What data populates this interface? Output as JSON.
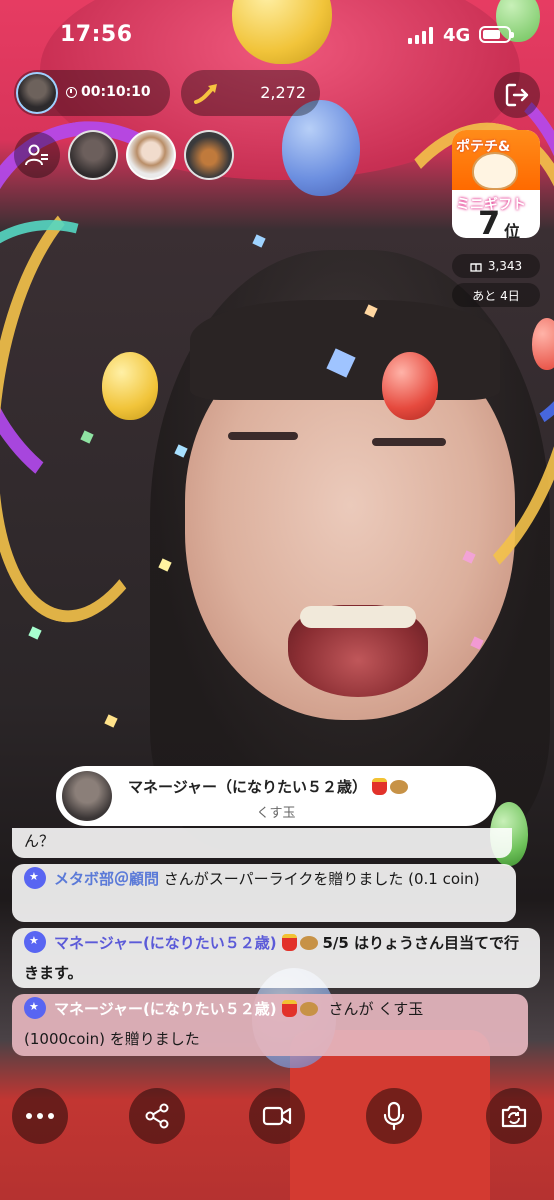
{
  "status_bar": {
    "time": "17:56",
    "network": "4G"
  },
  "stream": {
    "elapsed_time": "00:10:10",
    "score": "2,272",
    "icons": {
      "timer": "clock-icon",
      "score": "trend-arrow-icon",
      "exit": "exit-icon",
      "viewers": "viewer-list-icon"
    }
  },
  "event": {
    "title_line1": "ポテチ&",
    "title_line2": "ミニギフト",
    "rank": "7",
    "rank_unit": "位",
    "gift_count": "3,343",
    "days_left": "あと 4日"
  },
  "gift_banner": {
    "sender": "マネージャー（になりたい５２歳）",
    "item": "くす玉"
  },
  "comments": [
    {
      "id": "c0",
      "text": "ん？"
    },
    {
      "id": "c1",
      "user": "メタボ部＠顧問",
      "text": "さんがスーパーライクを贈りました (0.1 coin)"
    },
    {
      "id": "c2",
      "user": "マネージャー(になりたい５２歳)",
      "text": "5/5 はりょうさん目当てで行きます。"
    },
    {
      "id": "c3",
      "user": "マネージャー(になりたい５２歳)",
      "text_part1": "さんが くす玉",
      "text_part2": "(1000coin) を贈りました"
    }
  ],
  "bottom_bar": {
    "icons": [
      "more-icon",
      "share-icon",
      "video-camera-icon",
      "microphone-icon",
      "camera-flip-icon"
    ]
  },
  "colors": {
    "accent": "#5865f2",
    "gift_highlight": "#e4b5bd",
    "event_orange": "#ff7a00"
  }
}
